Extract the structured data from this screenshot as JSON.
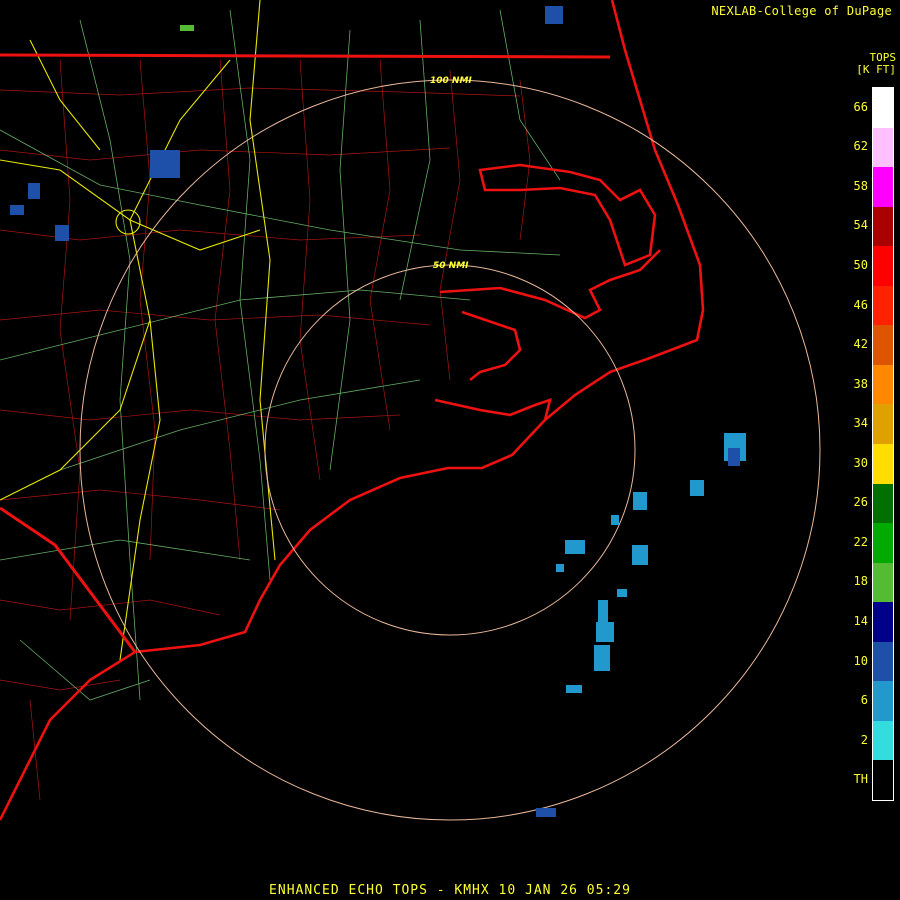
{
  "credit": "NEXLAB-College of DuPage",
  "legend": {
    "title_line1": "TOPS",
    "title_line2": "[K FT]",
    "ticks": [
      "66",
      "62",
      "58",
      "54",
      "50",
      "46",
      "42",
      "38",
      "34",
      "30",
      "26",
      "22",
      "18",
      "14",
      "10",
      "6",
      "2",
      "TH"
    ],
    "colors": [
      "#ffffff",
      "#ffc0ff",
      "#ff00ff",
      "#aa0000",
      "#ff0000",
      "#ff2200",
      "#dd5500",
      "#ff8800",
      "#e0a000",
      "#ffdd00",
      "#007000",
      "#00aa00",
      "#55bb33",
      "#000088",
      "#1e50aa",
      "#2299cc",
      "#33dddd",
      "#000000"
    ]
  },
  "rings": [
    {
      "label": "100 NMI"
    },
    {
      "label": "50 NMI"
    }
  ],
  "caption": "ENHANCED ECHO TOPS - KMHX 10 JAN 26 05:29"
}
